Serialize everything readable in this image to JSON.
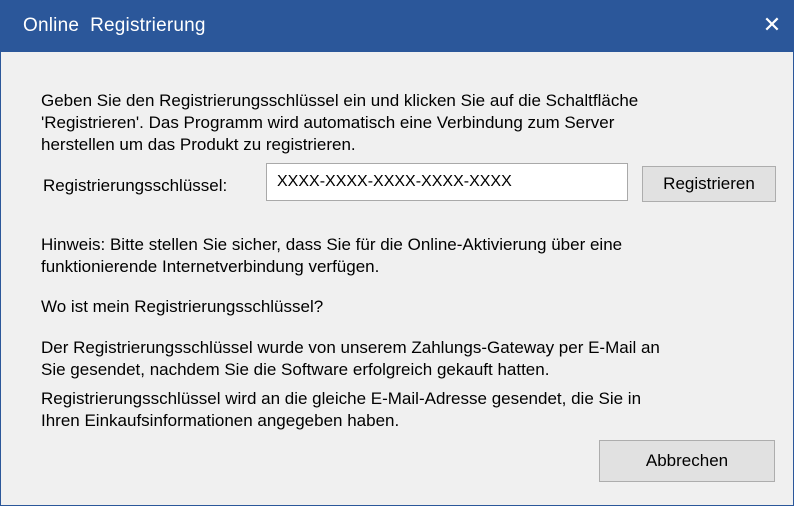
{
  "window": {
    "title": "Online  Registrierung",
    "close_symbol": "✕",
    "close_icon": "close-icon"
  },
  "intro": {
    "line1": "Geben Sie den Registrierungsschlüssel ein und klicken Sie auf die Schaltfläche",
    "line2": "'Registrieren'. Das Programm wird automatisch eine Verbindung zum Server",
    "line3": "herstellen um das Produkt zu registrieren."
  },
  "registration": {
    "key_label": "Registrierungsschlüssel:",
    "key_value": "XXXX-XXXX-XXXX-XXXX-XXXX",
    "register_button": "Registrieren"
  },
  "hint": {
    "line1": "Hinweis: Bitte stellen Sie sicher, dass Sie für die Online-Aktivierung über eine",
    "line2": "funktionierende Internetverbindung verfügen."
  },
  "faq": {
    "question": "Wo ist mein Registrierungsschlüssel?",
    "answer1_line1": "Der Registrierungsschlüssel wurde von unserem Zahlungs-Gateway per E-Mail an",
    "answer1_line2": "Sie gesendet, nachdem Sie die Software erfolgreich gekauft hatten.",
    "answer2_line1": "Registrierungsschlüssel wird an die gleiche E-Mail-Adresse gesendet, die Sie in",
    "answer2_line2": "Ihren Einkaufsinformationen angegeben haben."
  },
  "footer": {
    "cancel_button": "Abbrechen"
  },
  "colors": {
    "titlebar": "#2b579a",
    "dialog_background": "#f0f0f0",
    "button_background": "#e1e1e1"
  }
}
